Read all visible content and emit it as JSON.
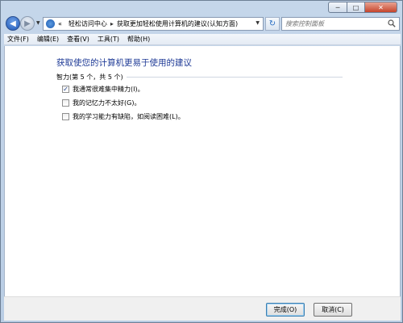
{
  "window": {
    "min_glyph": "─",
    "max_glyph": "□",
    "close_glyph": "✕"
  },
  "nav": {
    "back_glyph": "◀",
    "forward_glyph": "▶",
    "dropdown_glyph": "▼"
  },
  "address": {
    "prefix": "«",
    "crumb_1": "轻松访问中心",
    "sep": "▸",
    "crumb_2": "获取更加轻松使用计算机的建议(认知方面)",
    "dropdown_glyph": "▼",
    "refresh_glyph": "↻"
  },
  "search": {
    "placeholder": "搜索控制面板"
  },
  "menu": {
    "items": [
      "文件(F)",
      "编辑(E)",
      "查看(V)",
      "工具(T)",
      "帮助(H)"
    ]
  },
  "main": {
    "title": "获取使您的计算机更易于使用的建议",
    "group_label": "智力(第 5 个，共 5 个)",
    "options": [
      {
        "label": "我通常很难集中精力(I)。",
        "checked": true,
        "check_glyph": "✓"
      },
      {
        "label": "我的记忆力不太好(G)。",
        "checked": false,
        "check_glyph": ""
      },
      {
        "label": "我的学习能力有缺陷，如阅读困难(L)。",
        "checked": false,
        "check_glyph": ""
      }
    ]
  },
  "footer": {
    "finish_label": "完成(O)",
    "cancel_label": "取消(C)"
  },
  "colors": {
    "title_blue": "#1e3a96",
    "frame": "#c5d6ea",
    "close_red": "#c6442b"
  }
}
